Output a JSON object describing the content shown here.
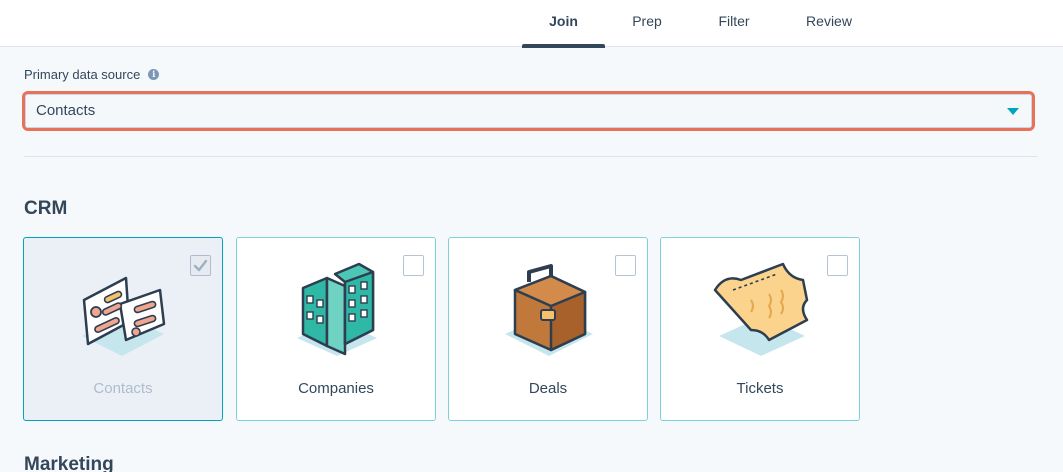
{
  "tabs": [
    {
      "label": "Join",
      "active": true
    },
    {
      "label": "Prep",
      "active": false
    },
    {
      "label": "Filter",
      "active": false
    },
    {
      "label": "Review",
      "active": false
    }
  ],
  "primary_source": {
    "label": "Primary data source",
    "value": "Contacts",
    "info_icon": "info-icon"
  },
  "sections": {
    "crm": "CRM",
    "marketing": "Marketing"
  },
  "cards": [
    {
      "label": "Contacts",
      "icon": "contact-card-icon",
      "checked": true
    },
    {
      "label": "Companies",
      "icon": "building-icon",
      "checked": false
    },
    {
      "label": "Deals",
      "icon": "briefcase-icon",
      "checked": false
    },
    {
      "label": "Tickets",
      "icon": "ticket-icon",
      "checked": false
    }
  ],
  "colors": {
    "accent": "#00a4bd",
    "highlight": "#e8715a",
    "text": "#33475b"
  }
}
